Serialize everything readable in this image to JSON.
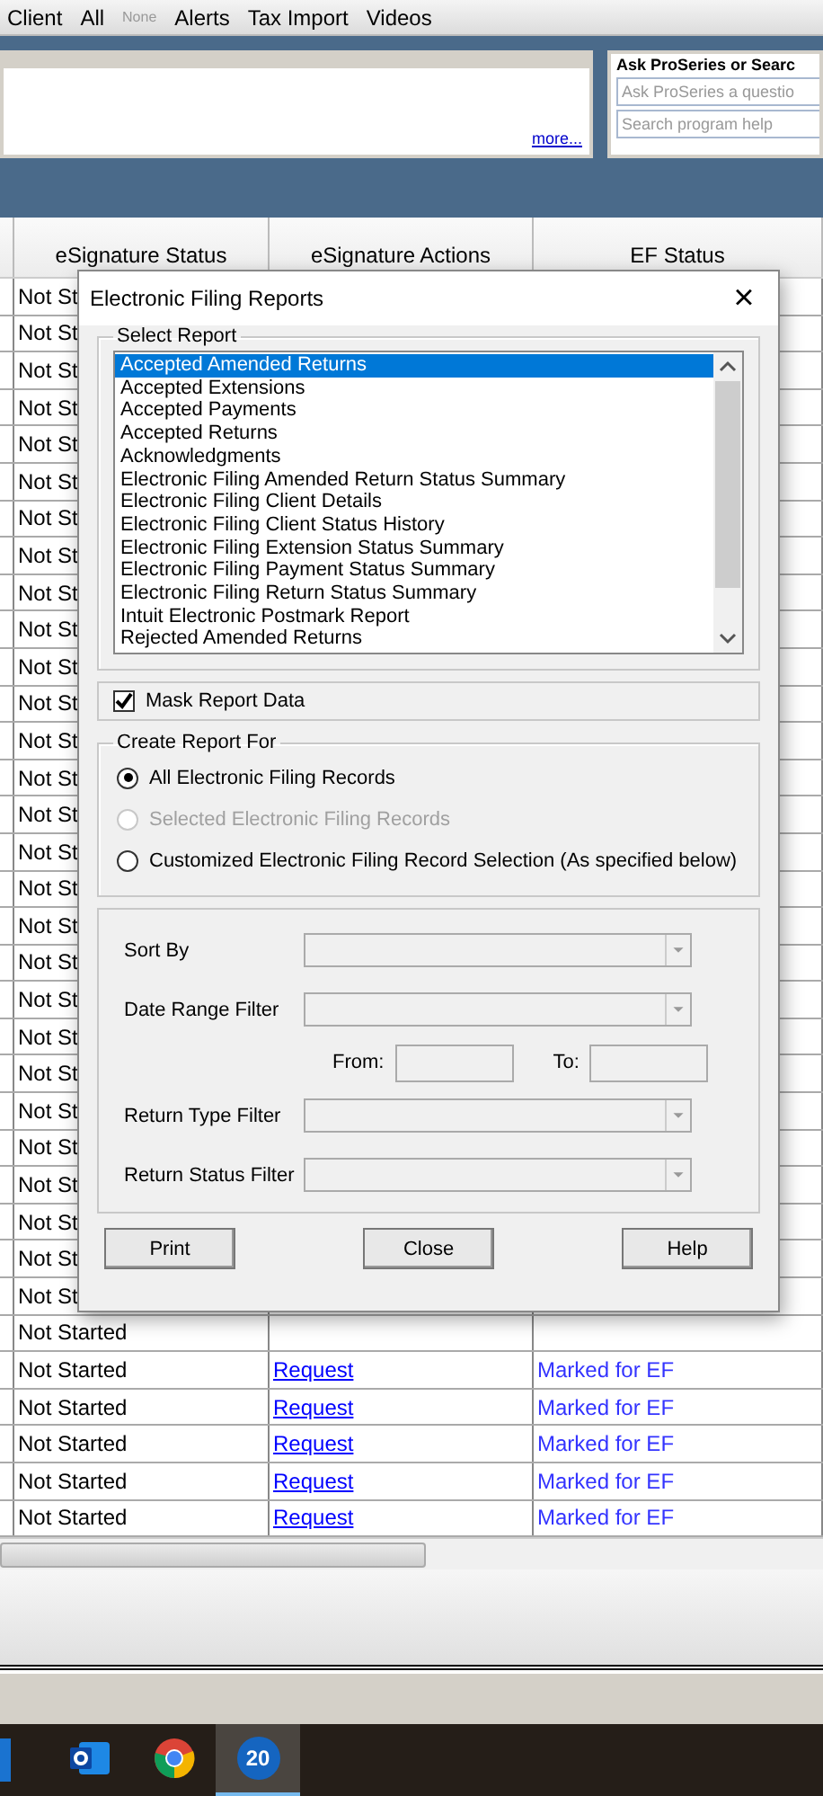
{
  "toolbar": {
    "items": [
      {
        "label": "Client"
      },
      {
        "label": "All"
      },
      {
        "label": "None",
        "kind": "small"
      },
      {
        "label": "Alerts"
      },
      {
        "label": "Tax Import"
      },
      {
        "label": "Videos"
      }
    ]
  },
  "news_panel": {
    "link": "more..."
  },
  "ask_panel": {
    "title": "Ask ProSeries or Searc",
    "fields": [
      {
        "placeholder": "Ask ProSeries a questio"
      },
      {
        "placeholder": "Search program help"
      }
    ]
  },
  "grid": {
    "columns": [
      "eSignature Status",
      "eSignature Actions",
      "EF Status"
    ],
    "rows": [
      {
        "status": "Not St"
      },
      {
        "status": "Not St"
      },
      {
        "status": "Not St"
      },
      {
        "status": "Not St"
      },
      {
        "status": "Not St"
      },
      {
        "status": "Not St"
      },
      {
        "status": "Not St"
      },
      {
        "status": "Not St"
      },
      {
        "status": "Not St"
      },
      {
        "status": "Not St"
      },
      {
        "status": "Not St"
      },
      {
        "status": "Not St"
      },
      {
        "status": "Not St"
      },
      {
        "status": "Not St"
      },
      {
        "status": "Not St"
      },
      {
        "status": "Not St"
      },
      {
        "status": "Not St"
      },
      {
        "status": "Not St"
      },
      {
        "status": "Not St"
      },
      {
        "status": "Not St"
      },
      {
        "status": "Not St"
      },
      {
        "status": "Not St"
      },
      {
        "status": "Not St"
      },
      {
        "status": "Not St"
      },
      {
        "status": "Not St"
      },
      {
        "status": "Not St"
      },
      {
        "status": "Not St"
      },
      {
        "status": "Not St"
      },
      {
        "status": "Not Started"
      },
      {
        "status": "Not Started",
        "action": "Request",
        "ef_status": "Marked for EF"
      },
      {
        "status": "Not Started",
        "action": "Request",
        "ef_status": "Marked for EF"
      },
      {
        "status": "Not Started",
        "action": "Request",
        "ef_status": "Marked for EF"
      },
      {
        "status": "Not Started",
        "action": "Request",
        "ef_status": "Marked for EF"
      },
      {
        "status": "Not Started",
        "action": "Request",
        "ef_status": "Marked for EF"
      }
    ]
  },
  "dialog": {
    "title": "Electronic Filing Reports",
    "close": "×",
    "select_report": {
      "label": "Select Report",
      "items": [
        {
          "label": "Accepted Amended Returns",
          "selected": true
        },
        {
          "label": "Accepted Extensions",
          "selected": false
        },
        {
          "label": "Accepted Payments",
          "selected": false
        },
        {
          "label": "Accepted Returns",
          "selected": false
        },
        {
          "label": "Acknowledgments",
          "selected": false
        },
        {
          "label": "Electronic Filing Amended Return Status Summary",
          "selected": false
        },
        {
          "label": "Electronic Filing Client Details",
          "selected": false
        },
        {
          "label": "Electronic Filing Client Status History",
          "selected": false
        },
        {
          "label": "Electronic Filing Extension Status Summary",
          "selected": false
        },
        {
          "label": "Electronic Filing Payment Status Summary",
          "selected": false
        },
        {
          "label": "Electronic Filing Return Status Summary",
          "selected": false
        },
        {
          "label": "Intuit Electronic Postmark Report",
          "selected": false
        },
        {
          "label": "Rejected Amended Returns",
          "selected": false
        }
      ]
    },
    "mask": {
      "label": "Mask Report Data",
      "checked": true
    },
    "create_report_for": {
      "label": "Create Report For",
      "options": [
        {
          "label": "All Electronic Filing Records",
          "selected": true,
          "disabled": false
        },
        {
          "label": "Selected Electronic Filing Records",
          "selected": false,
          "disabled": true
        },
        {
          "label": "Customized Electronic Filing Record Selection (As specified below)",
          "selected": false,
          "disabled": false
        }
      ]
    },
    "filters": [
      {
        "kind": "dropdown",
        "label": "Sort By"
      },
      {
        "kind": "dropdown",
        "label": "Date Range Filter"
      },
      {
        "kind": "range",
        "from_label": "From:",
        "to_label": "To:"
      },
      {
        "kind": "dropdown",
        "label": "Return Type Filter"
      },
      {
        "kind": "dropdown",
        "label": "Return Status Filter"
      }
    ],
    "buttons": [
      "Print",
      "Close",
      "Help"
    ]
  },
  "taskbar": {
    "items": [
      {
        "kind": "outlook",
        "selected": false
      },
      {
        "kind": "chrome",
        "selected": false
      },
      {
        "kind": "app",
        "label": "20",
        "selected": true
      }
    ]
  }
}
